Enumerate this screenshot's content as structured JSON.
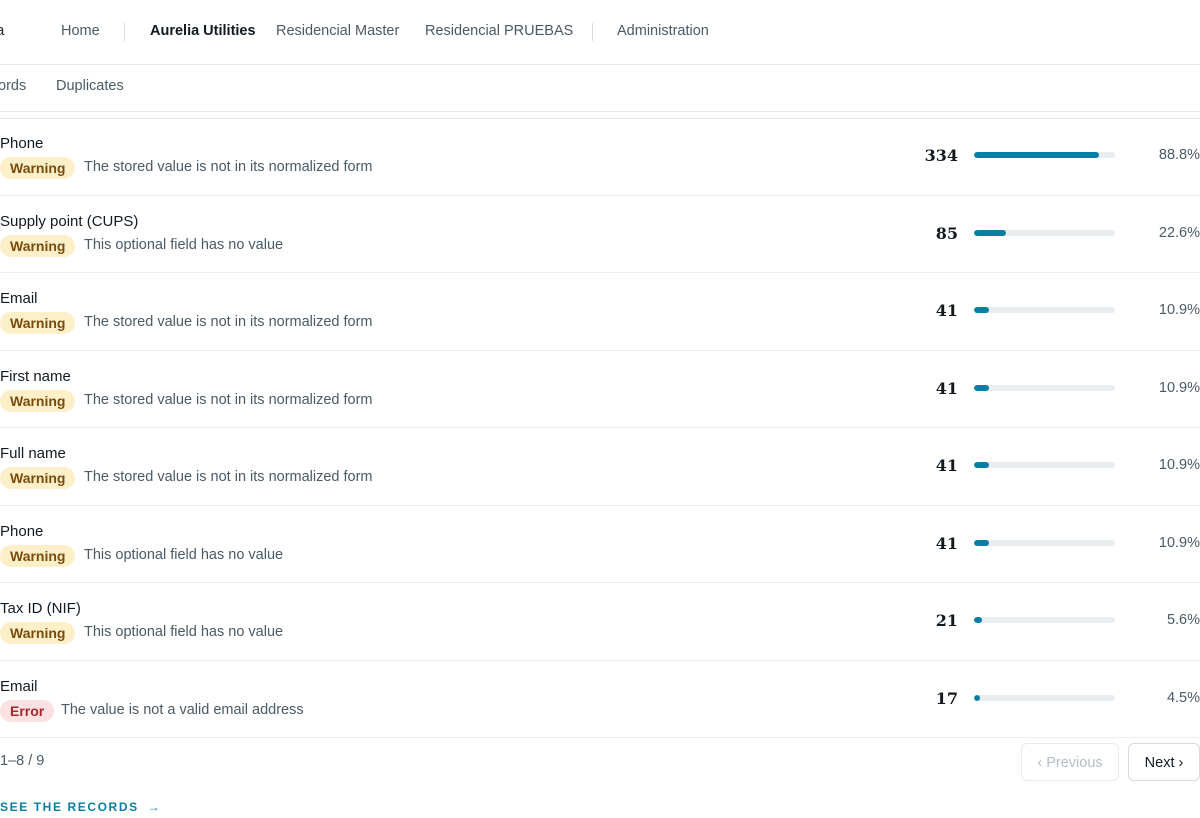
{
  "nav": {
    "logo_fragment": "a",
    "items": [
      {
        "label": "Home"
      },
      {
        "label": "Aurelia Utilities"
      },
      {
        "label": "Residencial Master"
      },
      {
        "label": "Residencial PRUEBAS"
      },
      {
        "label": "Administration"
      }
    ]
  },
  "subnav": {
    "items": [
      {
        "label": "ords"
      },
      {
        "label": "Duplicates"
      }
    ]
  },
  "rows": [
    {
      "field": "Phone",
      "severity": "Warning",
      "message": "The stored value is not in its normalized form",
      "count": "334",
      "percent": "88.8%",
      "fraction": 0.888
    },
    {
      "field": "Supply point (CUPS)",
      "severity": "Warning",
      "message": "This optional field has no value",
      "count": "85",
      "percent": "22.6%",
      "fraction": 0.226
    },
    {
      "field": "Email",
      "severity": "Warning",
      "message": "The stored value is not in its normalized form",
      "count": "41",
      "percent": "10.9%",
      "fraction": 0.109
    },
    {
      "field": "First name",
      "severity": "Warning",
      "message": "The stored value is not in its normalized form",
      "count": "41",
      "percent": "10.9%",
      "fraction": 0.109
    },
    {
      "field": "Full name",
      "severity": "Warning",
      "message": "The stored value is not in its normalized form",
      "count": "41",
      "percent": "10.9%",
      "fraction": 0.109
    },
    {
      "field": "Phone",
      "severity": "Warning",
      "message": "This optional field has no value",
      "count": "41",
      "percent": "10.9%",
      "fraction": 0.109
    },
    {
      "field": "Tax ID (NIF)",
      "severity": "Warning",
      "message": "This optional field has no value",
      "count": "21",
      "percent": "5.6%",
      "fraction": 0.056
    },
    {
      "field": "Email",
      "severity": "Error",
      "message": "The value is not a valid email address",
      "count": "17",
      "percent": "4.5%",
      "fraction": 0.045
    }
  ],
  "pagination": {
    "range": "1–8 / 9",
    "previous_label": "‹ Previous",
    "next_label": "Next ›"
  },
  "see_records": {
    "label": "SEE THE RECORDS",
    "arrow": "→"
  },
  "colors": {
    "accent": "#0b7ea6",
    "warning_bg": "#fdf0c8",
    "warning_text": "#7a4b0c",
    "error_bg": "#fbe1e1",
    "error_text": "#a22a2a"
  }
}
